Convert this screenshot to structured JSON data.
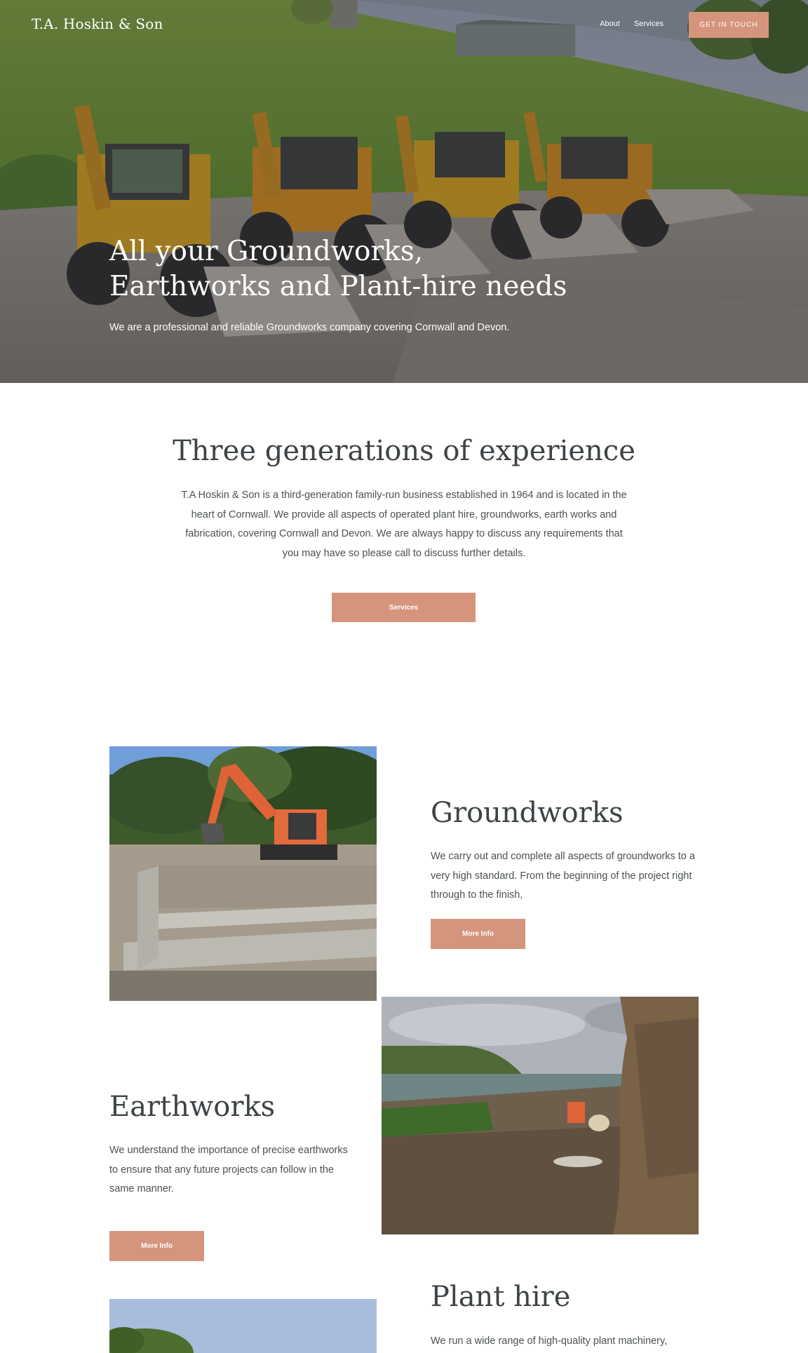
{
  "header": {
    "brand": "T.A. Hoskin & Son",
    "nav": [
      "About",
      "Services"
    ],
    "cta_label": "GET IN TOUCH"
  },
  "hero": {
    "title": "All your Groundworks, Earthworks and Plant-hire needs",
    "subtitle": "We are a professional and reliable Groundworks company covering Cornwall and Devon."
  },
  "intro": {
    "title": "Three generations of experience",
    "text": "T.A Hoskin & Son is a third-generation family-run business established in 1964 and is located in the heart of Cornwall. We provide all aspects of operated plant hire, groundworks, earth works and fabrication, covering Cornwall and Devon. We are always happy to discuss any requirements that you may have so please call to discuss further details.",
    "button_label": "Services"
  },
  "services": {
    "groundworks": {
      "title": "Groundworks",
      "text": "We carry out and complete all aspects of groundworks to a very high standard. From the beginning of the project right through to the finish,",
      "button_label": "More Info"
    },
    "earthworks": {
      "title": "Earthworks",
      "text": "We understand the importance of precise earthworks to ensure that any future projects can follow in the same manner.",
      "button_label": "More Info"
    },
    "plant_hire": {
      "title": "Plant hire",
      "text": "We run a wide range of high-quality plant machinery,"
    }
  },
  "colors": {
    "accent": "#d4957c",
    "text": "#3d4346",
    "background": "#ffffff"
  }
}
